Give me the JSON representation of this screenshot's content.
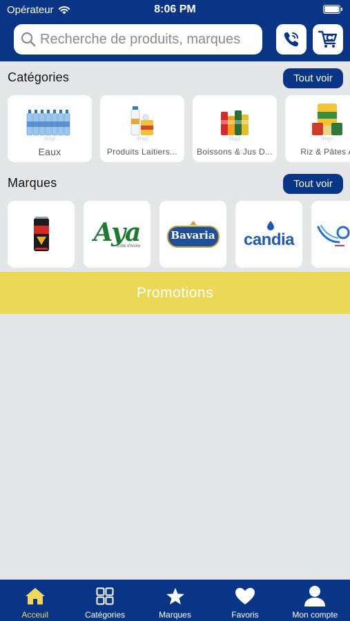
{
  "status_bar": {
    "carrier": "Opérateur",
    "time": "8:06 PM"
  },
  "search": {
    "placeholder": "Recherche de produits, marques"
  },
  "categories": {
    "title": "Catégories",
    "see_all": "Tout voir",
    "items": [
      {
        "label": "Eaux",
        "watermark": "dlogo"
      },
      {
        "label": "Produits Laitiers...",
        "watermark": "dlogo"
      },
      {
        "label": "Boissons & Jus D...",
        "watermark": "dlogo"
      },
      {
        "label": "Riz & Pâtes A",
        "watermark": "dlogo"
      }
    ]
  },
  "brands": {
    "title": "Marques",
    "see_all": "Tout voir",
    "items": [
      {
        "logo": "energy-drink-can"
      },
      {
        "logo": "Aya",
        "sub": "Côte d'Ivoire"
      },
      {
        "logo": "Bavaria"
      },
      {
        "logo": "candia"
      },
      {
        "logo": "partial-brand"
      }
    ]
  },
  "promo": {
    "label": "Promotions"
  },
  "tabbar": {
    "items": [
      {
        "label": "Acceuil",
        "icon": "home-icon",
        "active": true
      },
      {
        "label": "Catégories",
        "icon": "grid-icon"
      },
      {
        "label": "Marques",
        "icon": "star-icon"
      },
      {
        "label": "Favoris",
        "icon": "heart-icon"
      },
      {
        "label": "Mon compte",
        "icon": "user-icon"
      }
    ]
  },
  "colors": {
    "primary": "#0a3587",
    "promo": "#ebd857",
    "active_tab": "#f0d65a",
    "background": "#e5e6e8"
  }
}
